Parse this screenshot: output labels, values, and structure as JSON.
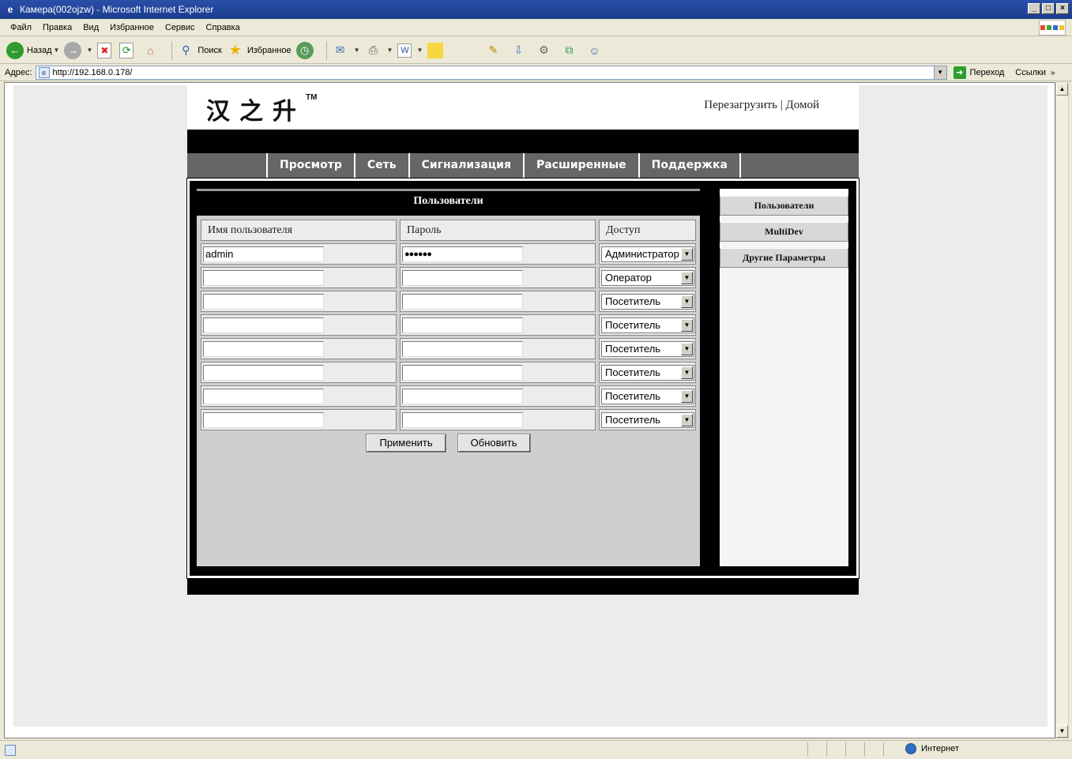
{
  "window": {
    "title": "Камера(002ojzw) - Microsoft Internet Explorer",
    "controls": [
      "_",
      "□",
      "×"
    ]
  },
  "menu": [
    "Файл",
    "Правка",
    "Вид",
    "Избранное",
    "Сервис",
    "Справка"
  ],
  "toolbar": {
    "back_label": "Назад",
    "search_label": "Поиск",
    "favorites_label": "Избранное"
  },
  "address": {
    "label": "Адрес:",
    "url": "http://192.168.0.178/",
    "go_label": "Переход",
    "links_label": "Ссылки"
  },
  "status": {
    "zone_label": "Интернет"
  },
  "page": {
    "logo": "汉之升",
    "logo_tm": "TM",
    "header_links": {
      "reboot": "Перезагрузить",
      "separator": "|",
      "home": "Домой"
    },
    "nav_tabs": [
      "Просмотр",
      "Сеть",
      "Сигнализация",
      "Расширенные",
      "Поддержка"
    ],
    "panel_title": "Пользователи",
    "columns": [
      "Имя пользователя",
      "Пароль",
      "Доступ"
    ],
    "rows": [
      {
        "username": "admin",
        "password": "●●●●●●",
        "access": "Администратор"
      },
      {
        "username": "",
        "password": "",
        "access": "Оператор"
      },
      {
        "username": "",
        "password": "",
        "access": "Посетитель"
      },
      {
        "username": "",
        "password": "",
        "access": "Посетитель"
      },
      {
        "username": "",
        "password": "",
        "access": "Посетитель"
      },
      {
        "username": "",
        "password": "",
        "access": "Посетитель"
      },
      {
        "username": "",
        "password": "",
        "access": "Посетитель"
      },
      {
        "username": "",
        "password": "",
        "access": "Посетитель"
      }
    ],
    "apply_label": "Применить",
    "refresh_label": "Обновить",
    "side_menu": [
      "Пользователи",
      "MultiDev",
      "Другие Параметры"
    ]
  },
  "colors": {
    "titlebar": "#1c3d8f",
    "nav_bg": "#666666",
    "panel_gray": "#cfcfcf",
    "black": "#000000"
  }
}
